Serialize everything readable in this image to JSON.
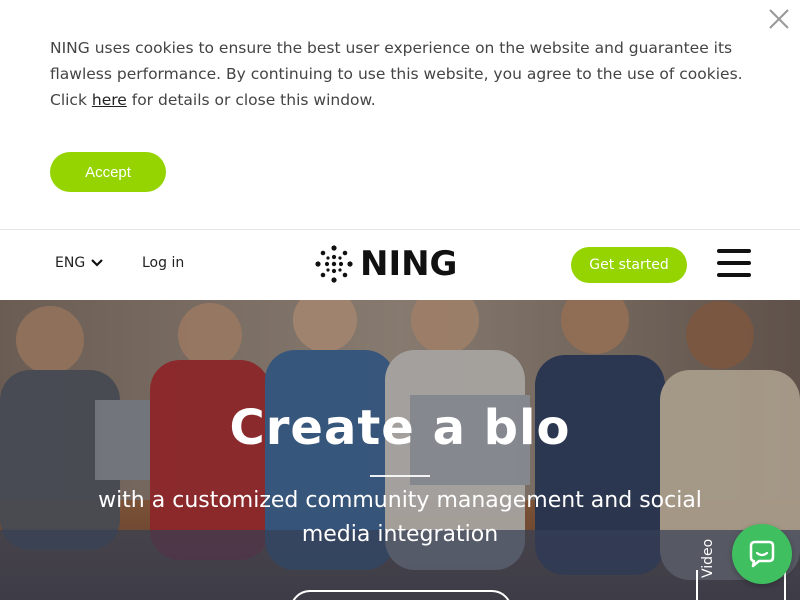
{
  "cookie_banner": {
    "text_before_link": "NING uses cookies to ensure the best user experience on the website and guarantee its flawless performance. By continuing to use this website, you agree to the use of cookies. Click ",
    "link_label": "here",
    "text_after_link": " for details or close this window.",
    "accept_label": "Accept"
  },
  "header": {
    "language": "ENG",
    "login_label": "Log in",
    "logo_text": "NING",
    "get_started_label": "Get started"
  },
  "hero": {
    "title": "Create a blo",
    "subtitle": "with a customized community management and social media integration",
    "side_tab_label": "Video"
  },
  "colors": {
    "accent": "#95d400",
    "chat": "#3fbf60"
  },
  "icons": [
    "close-icon",
    "chevron-down-icon",
    "ning-logo-icon",
    "hamburger-menu-icon",
    "chat-icon"
  ]
}
